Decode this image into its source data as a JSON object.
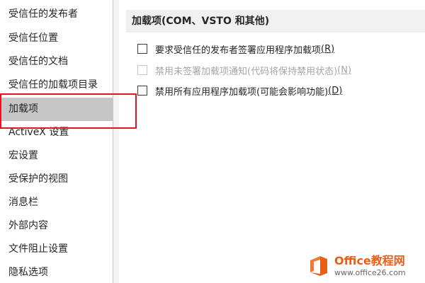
{
  "sidebar": {
    "items": [
      {
        "label": "受信任的发布者"
      },
      {
        "label": "受信任位置"
      },
      {
        "label": "受信任的文档"
      },
      {
        "label": "受信任的加载项目录"
      },
      {
        "label": "加载项"
      },
      {
        "label": "ActiveX 设置"
      },
      {
        "label": "宏设置"
      },
      {
        "label": "受保护的视图"
      },
      {
        "label": "消息栏"
      },
      {
        "label": "外部内容"
      },
      {
        "label": "文件阻止设置"
      },
      {
        "label": "隐私选项"
      }
    ],
    "selected_index": 4
  },
  "main": {
    "section_title": "加载项(COM、VSTO 和其他)",
    "options": [
      {
        "label": "要求受信任的发布者签署应用程序加载项",
        "accel": "(R)",
        "checked": false,
        "enabled": true
      },
      {
        "label": "禁用未签署加载项通知(代码将保持禁用状态)",
        "accel": "(N)",
        "checked": false,
        "enabled": false
      },
      {
        "label": "禁用所有应用程序加载项(可能会影响功能)",
        "accel": "(D)",
        "checked": false,
        "enabled": true
      }
    ]
  },
  "watermark": {
    "title": "Office教程网",
    "url": "www.office26.com"
  },
  "colors": {
    "selected_bg": "#c6c6c6",
    "highlight_border": "#e81123",
    "watermark_orange": "#ea5f17"
  }
}
